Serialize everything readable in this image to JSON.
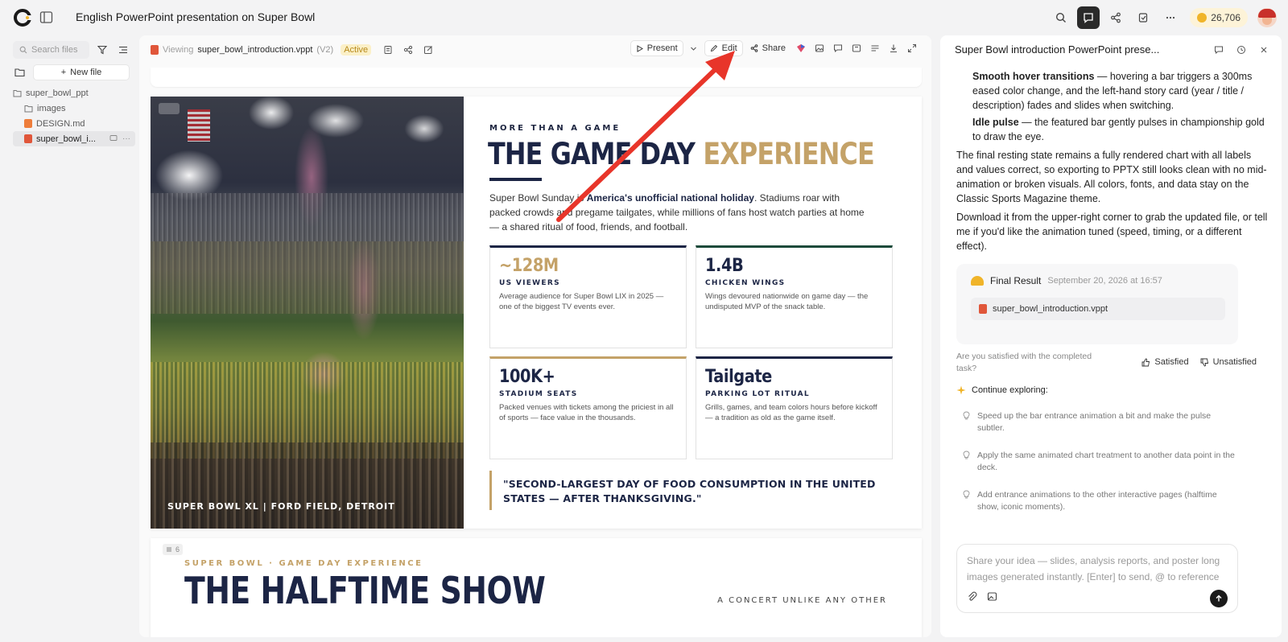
{
  "app": {
    "title": "English PowerPoint presentation on Super Bowl",
    "credits": "26,706"
  },
  "files": {
    "search_placeholder": "Search files",
    "new_file_label": "New file",
    "tree": [
      {
        "name": "super_bowl_ppt",
        "type": "folder",
        "level": 0
      },
      {
        "name": "images",
        "type": "folder",
        "level": 1
      },
      {
        "name": "DESIGN.md",
        "type": "markdown",
        "level": 1
      },
      {
        "name": "super_bowl_i...",
        "type": "presentation",
        "level": 1,
        "selected": true
      }
    ]
  },
  "viewer": {
    "viewing_label": "Viewing",
    "file_name": "super_bowl_introduction.vppt",
    "version": "(V2)",
    "status": "Active",
    "present_label": "Present",
    "edit_label": "Edit",
    "share_label": "Share"
  },
  "slide": {
    "photo_caption": "SUPER BOWL XL | FORD FIELD, DETROIT",
    "kicker": "MORE THAN A GAME",
    "headline_main": "THE GAME DAY",
    "headline_accent": "EXPERIENCE",
    "intro_pre": "Super Bowl Sunday is ",
    "intro_bold": "America's unofficial national holiday",
    "intro_post": ". Stadiums roar with packed crowds and pregame tailgates, while millions of fans host watch parties at home — a shared ritual of food, friends, and football.",
    "cards": [
      {
        "big": "~128M",
        "label": "US VIEWERS",
        "desc": "Average audience for Super Bowl LIX in 2025 — one of the biggest TV events ever."
      },
      {
        "big": "1.4B",
        "label": "CHICKEN WINGS",
        "desc": "Wings devoured nationwide on game day — the undisputed MVP of the snack table."
      },
      {
        "big": "100K+",
        "label": "STADIUM SEATS",
        "desc": "Packed venues with tickets among the priciest in all of sports — face value in the thousands."
      },
      {
        "big": "Tailgate",
        "label": "PARKING LOT RITUAL",
        "desc": "Grills, games, and team colors hours before kickoff — a tradition as old as the game itself."
      }
    ],
    "quote": "\"SECOND-LARGEST DAY OF FOOD CONSUMPTION IN THE UNITED STATES — AFTER THANKSGIVING.\""
  },
  "slide_next": {
    "number": "6",
    "kicker": "SUPER BOWL · GAME DAY EXPERIENCE",
    "headline": "THE HALFTIME SHOW",
    "subtitle": "A CONCERT UNLIKE ANY OTHER"
  },
  "chat": {
    "title": "Super Bowl introduction PowerPoint prese...",
    "bullets": [
      {
        "bold": "Smooth hover transitions",
        "text": " — hovering a bar triggers a 300ms eased color change, and the left-hand story card (year / title / description) fades and slides when switching."
      },
      {
        "bold": "Idle pulse",
        "text": " — the featured bar gently pulses in championship gold to draw the eye."
      }
    ],
    "para1": "The final resting state remains a fully rendered chart with all labels and values correct, so exporting to PPTX still looks clean with no mid-animation or broken visuals. All colors, fonts, and data stay on the Classic Sports Magazine theme.",
    "para2": "Download it from the upper-right corner to grab the updated file, or tell me if you'd like the animation tuned (speed, timing, or a different effect).",
    "result_title": "Final Result",
    "result_time": "September 20, 2026 at 16:57",
    "result_file": "super_bowl_introduction.vppt",
    "satisfaction_question": "Are you satisfied with the completed task?",
    "satisfied_label": "Satisfied",
    "unsatisfied_label": "Unsatisfied",
    "explore_label": "Continue exploring:",
    "suggestions": [
      "Speed up the bar entrance animation a bit and make the pulse subtler.",
      "Apply the same animated chart treatment to another data point in the deck.",
      "Add entrance animations to the other interactive pages (halftime show, iconic moments)."
    ],
    "composer_placeholder": "Share your idea — slides, analysis reports, and poster long images generated instantly. [Enter] to send, @ to reference"
  },
  "colors": {
    "navy": "#1c2545",
    "gold": "#c4a268",
    "annotation_arrow": "#e8352a"
  }
}
